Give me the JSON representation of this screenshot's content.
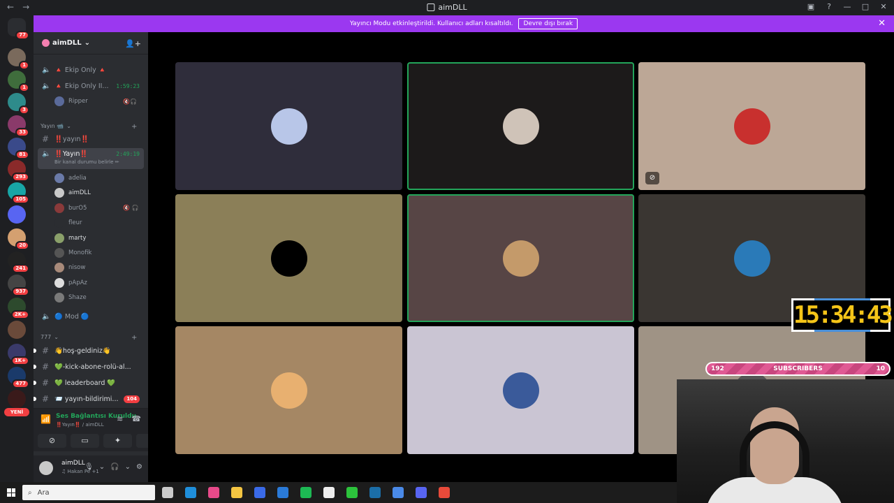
{
  "window": {
    "title": "aimDLL",
    "nav_back": "←",
    "nav_forward": "→"
  },
  "banner": {
    "message": "Yayıncı Modu etkinleştirildi. Kullanıcı adları kısaltıldı.",
    "button": "Devre dışı bırak",
    "close": "✕"
  },
  "rail": {
    "top_badge": "77",
    "yeni": "YENİ",
    "servers": [
      {
        "badge": "1",
        "color": "#7a6a5c"
      },
      {
        "badge": "1",
        "color": "#3f6d3c"
      },
      {
        "badge": "3",
        "color": "#2e8b8b"
      },
      {
        "badge": "33",
        "color": "#8a3a6a"
      },
      {
        "badge": "81",
        "color": "#3a4a8a"
      },
      {
        "badge": "293",
        "color": "#8a2a2a"
      },
      {
        "badge": "105",
        "color": "#18a6a6"
      },
      {
        "badge": "",
        "color": "#5865f2"
      },
      {
        "badge": "20",
        "color": "#d4a070"
      },
      {
        "badge": "241",
        "color": "#222222"
      },
      {
        "badge": "937",
        "color": "#444444"
      },
      {
        "badge": "2K+",
        "color": "#2d4a2d"
      },
      {
        "badge": "",
        "color": "#6a4a3a"
      },
      {
        "badge": "1K+",
        "color": "#3a3a6a"
      },
      {
        "badge": "477",
        "color": "#1a3a6a"
      },
      {
        "badge": "",
        "color": "#3a1a1a"
      }
    ]
  },
  "sidebar": {
    "guild_name": "aimDLL",
    "voice_top": [
      {
        "name": "🔺 Ekip Only 🔺",
        "time": ""
      },
      {
        "name": "🔺 Ekip Only II...",
        "time": "1:59:23"
      }
    ],
    "ripper": "Ripper",
    "cat_yayin": "Yayın 📹",
    "text_yayin": "‼️yayın‼️",
    "voice_yayin": "‼️Yayın‼️",
    "voice_yayin_time": "2:49:19",
    "voice_yayin_status": "Bir kanal durumu belirle ✏",
    "users": [
      {
        "name": "adelia",
        "color": "#6a7aa8",
        "bright": false,
        "icons": ""
      },
      {
        "name": "aimDLL",
        "color": "#c9c9c9",
        "bright": true,
        "icons": ""
      },
      {
        "name": "burO5",
        "color": "#8a3a3a",
        "bright": false,
        "icons": "🔇 🎧"
      },
      {
        "name": "fleur",
        "color": "#2b2d31",
        "bright": false,
        "icons": ""
      },
      {
        "name": "marty",
        "color": "#8aa06a",
        "bright": true,
        "icons": ""
      },
      {
        "name": "Monofik",
        "color": "#555555",
        "bright": false,
        "icons": ""
      },
      {
        "name": "nisow",
        "color": "#a88a7a",
        "bright": false,
        "icons": ""
      },
      {
        "name": "pApAz",
        "color": "#dddddd",
        "bright": false,
        "icons": ""
      },
      {
        "name": "Shaze",
        "color": "#7a7a7a",
        "bright": false,
        "icons": ""
      }
    ],
    "mod": "🔵 Mod 🔵",
    "cat_777": "777",
    "text_channels": [
      {
        "name": "👋hoş-geldiniz👋",
        "count": ""
      },
      {
        "name": "💚-kick-abone-rolü-al...",
        "count": ""
      },
      {
        "name": "💚 leaderboard 💚",
        "count": ""
      },
      {
        "name": "📨 yayın-bildirimi...",
        "count": "104"
      }
    ]
  },
  "voice_panel": {
    "status": "Ses Bağlantısı Kuruldu",
    "channel": "‼️Yayın‼️ / aimDLL"
  },
  "user_panel": {
    "name": "aimDLL",
    "activity": "♫ Hakan Pe +1"
  },
  "tiles": [
    {
      "bg": "#2f2d3b",
      "avatar": "#b8c6e8",
      "speaking": false,
      "flag": false
    },
    {
      "bg": "#1c1a1a",
      "avatar": "#cfc3b8",
      "speaking": true,
      "flag": false
    },
    {
      "bg": "#bca796",
      "avatar": "#c8302e",
      "speaking": false,
      "flag": true
    },
    {
      "bg": "#8b7f58",
      "avatar": "#000000",
      "speaking": false,
      "flag": false
    },
    {
      "bg": "#574545",
      "avatar": "#c49a6a",
      "speaking": true,
      "flag": false
    },
    {
      "bg": "#3a3632",
      "avatar": "#2a7ab8",
      "speaking": false,
      "flag": false
    },
    {
      "bg": "#a58764",
      "avatar": "#e8b070",
      "speaking": false,
      "flag": false
    },
    {
      "bg": "#cac5d3",
      "avatar": "#3a5a9a",
      "speaking": false,
      "flag": false
    },
    {
      "bg": "#9f9385",
      "avatar": "#555555",
      "speaking": false,
      "flag": false
    }
  ],
  "overlay": {
    "clock": "15:34:43",
    "subs_left": "192",
    "subs_label": "SUBSCRIBERS",
    "subs_right": "10"
  },
  "taskbar": {
    "search_placeholder": "Ara",
    "apps": [
      "#cccccc",
      "#1f8fdb",
      "#e84a8a",
      "#f4c542",
      "#3a6ae8",
      "#2a7ad8",
      "#1db954",
      "#eeeeee",
      "#2cc33c",
      "#1b6ea8",
      "#4a8ae8",
      "#5865f2",
      "#e84a3a"
    ]
  }
}
